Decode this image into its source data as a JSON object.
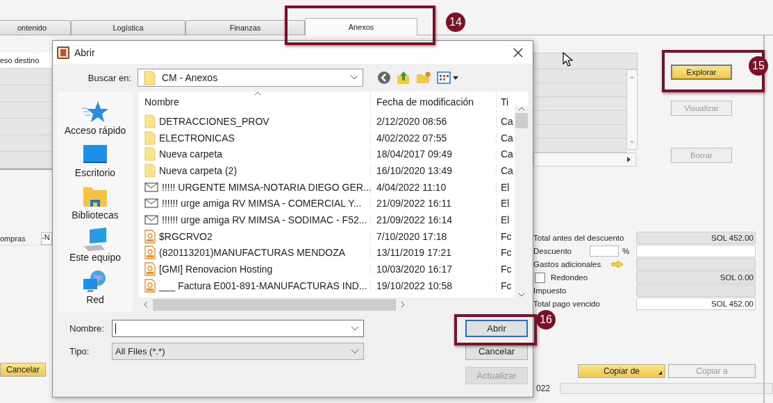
{
  "tabs": [
    {
      "label": "ontenido",
      "selected": false
    },
    {
      "label": "Logística",
      "selected": false
    },
    {
      "label": "Finanzas",
      "selected": false
    },
    {
      "label": "Anexos",
      "selected": true
    }
  ],
  "left_panel": {
    "column_header": "eso destino",
    "field_label": "ompras",
    "field_value": "-N"
  },
  "attachment_buttons": [
    {
      "label": "Explorar",
      "disabled": false
    },
    {
      "label": "Visualizar",
      "disabled": true
    },
    {
      "label": "Borrar",
      "disabled": true
    }
  ],
  "totals": [
    {
      "label": "Total antes del descuento",
      "kind": "readonly",
      "value": "SOL 452.00"
    },
    {
      "label": "Descuento",
      "kind": "percent",
      "sign": "%"
    },
    {
      "label": "Gastos adicionales",
      "kind": "arrow"
    },
    {
      "label": "Redondeo",
      "kind": "checkbox",
      "checked": false,
      "value": "SOL 0.00"
    },
    {
      "label": "Impuesto",
      "kind": "readonly"
    },
    {
      "label": "Total pago vencido",
      "kind": "editable",
      "value": "SOL 452.00"
    }
  ],
  "footer_buttons": [
    {
      "label": "Cancelar",
      "kind": "primary"
    },
    {
      "label": "Copiar de",
      "kind": "dropdown"
    },
    {
      "label": "Copiar a",
      "kind": "disabled"
    }
  ],
  "status": [
    "022"
  ],
  "callouts": [
    "14",
    "15",
    "16"
  ],
  "dialog": {
    "title": "Abrir",
    "look_in_label": "Buscar en:",
    "look_in_value": "CM - Anexos",
    "places": [
      {
        "label": "Acceso rápido",
        "kind": "star"
      },
      {
        "label": "Escritorio",
        "kind": "desktop"
      },
      {
        "label": "Bibliotecas",
        "kind": "library"
      },
      {
        "label": "Este equipo",
        "kind": "computer"
      },
      {
        "label": "Red",
        "kind": "network"
      }
    ],
    "columns": [
      "Nombre",
      "Fecha de modificación",
      "Ti"
    ],
    "files": [
      {
        "name": "DETRACCIONES_PROV",
        "date": "2/12/2020 08:56",
        "type": "Ca",
        "kind": "folder"
      },
      {
        "name": "ELECTRONICAS",
        "date": "4/02/2022 07:55",
        "type": "Ca",
        "kind": "folder"
      },
      {
        "name": "Nueva carpeta",
        "date": "18/04/2017 09:49",
        "type": "Ca",
        "kind": "folder"
      },
      {
        "name": "Nueva carpeta (2)",
        "date": "16/10/2020 13:49",
        "type": "Ca",
        "kind": "folder"
      },
      {
        "name": "!!!!! URGENTE   MIMSA-NOTARIA DIEGO GER...",
        "date": "4/04/2022 11:10",
        "type": "El",
        "kind": "mail"
      },
      {
        "name": "!!!!!! urge amiga RV MIMSA - COMERCIAL Y...",
        "date": "21/09/2022 16:11",
        "type": "El",
        "kind": "mail"
      },
      {
        "name": "!!!!!! urge amiga RV MIMSA - SODIMAC - F52...",
        "date": "21/09/2022 16:14",
        "type": "El",
        "kind": "mail"
      },
      {
        "name": "$RGCRVO2",
        "date": "7/10/2020 17:18",
        "type": "Fc",
        "kind": "pdf"
      },
      {
        "name": "(820113201)MANUFACTURAS MENDOZA",
        "date": "13/11/2019 17:21",
        "type": "Fc",
        "kind": "pdf"
      },
      {
        "name": "[GMI] Renovacion Hosting",
        "date": "10/03/2020 16:17",
        "type": "Fc",
        "kind": "pdf"
      },
      {
        "name": "___ Factura E001-891-MANUFACTURAS IND...",
        "date": "19/10/2022 10:58",
        "type": "Fc",
        "kind": "pdf"
      }
    ],
    "file_name_label": "Nombre:",
    "file_type_label": "Tipo:",
    "file_type": "All Files (*.*)",
    "buttons": [
      {
        "label": "Abrir",
        "kind": "default"
      },
      {
        "label": "Cancelar",
        "kind": "normal"
      },
      {
        "label": "Actualizar",
        "kind": "disabled"
      }
    ]
  }
}
